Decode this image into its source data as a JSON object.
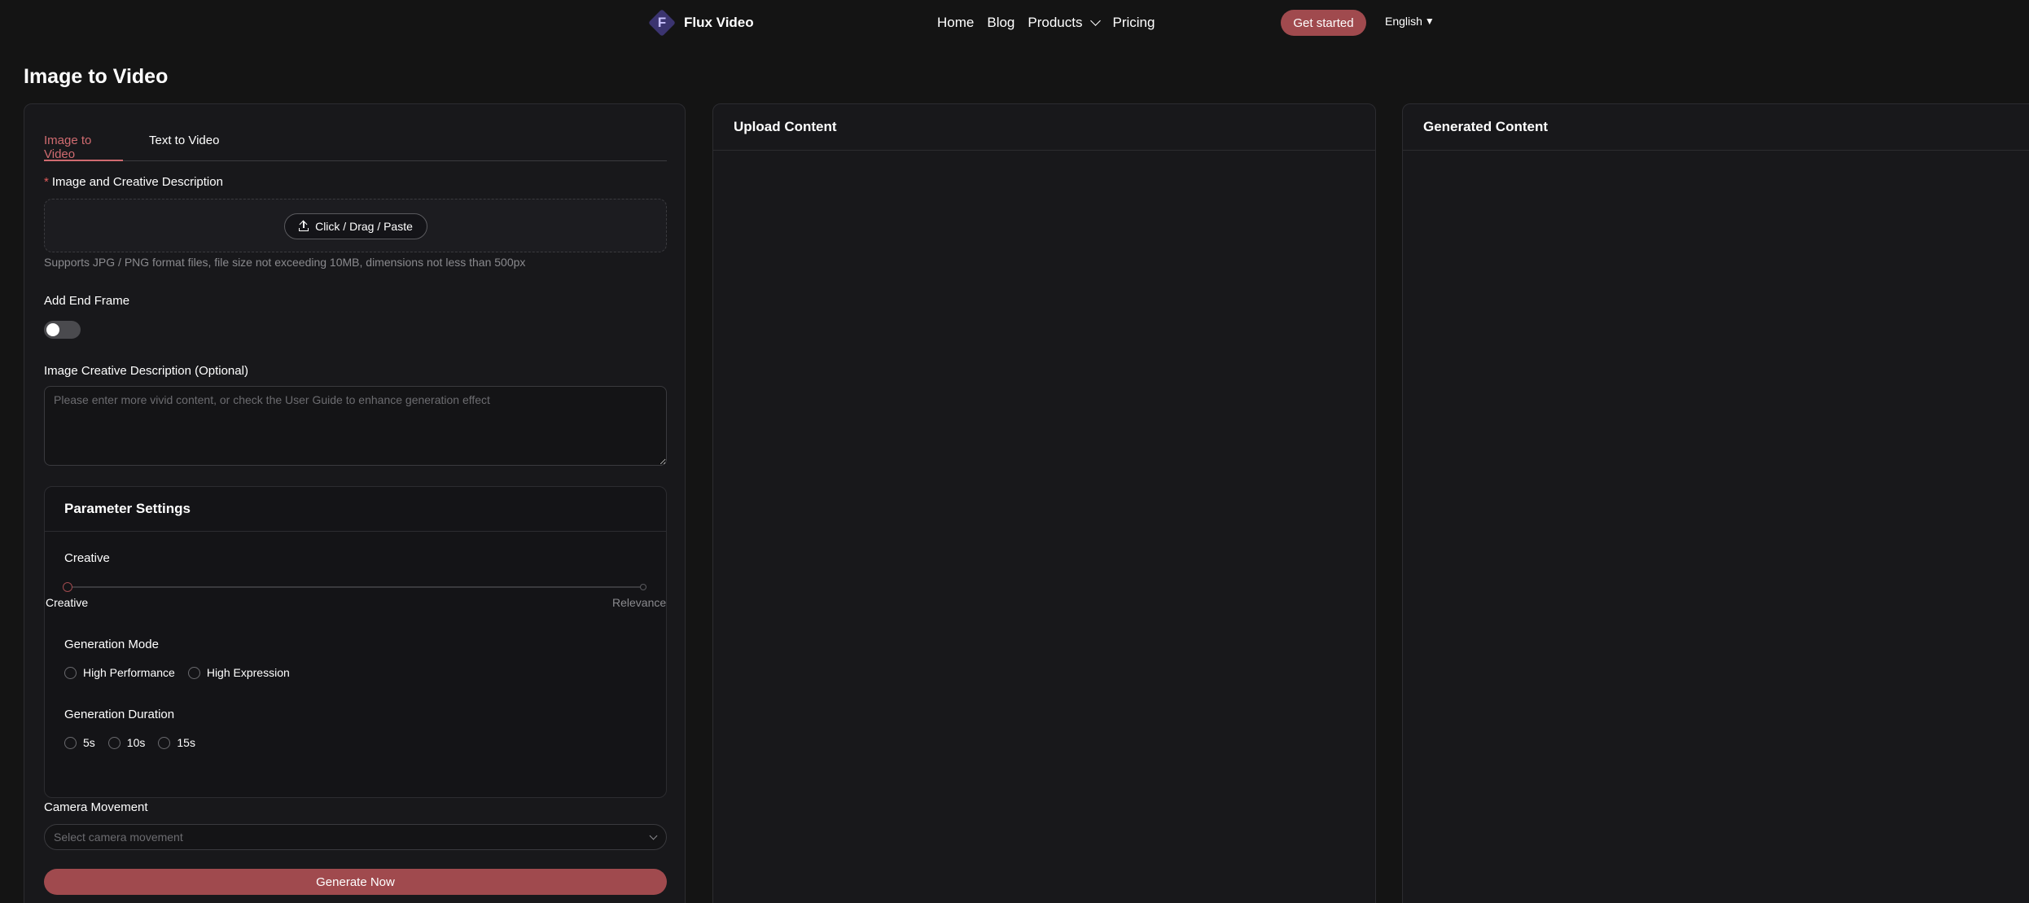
{
  "header": {
    "logo_letter": "F",
    "logo_text": "Flux Video",
    "nav": [
      "Home",
      "Blog",
      "Products",
      "Pricing"
    ],
    "get_started": "Get started",
    "language": "English",
    "language_arrow": "▼"
  },
  "page_title": "Image to Video",
  "left": {
    "tabs": [
      "Image to Video",
      "Text to Video"
    ],
    "active_tab": "Image to Video",
    "image_label": "Image and Creative Description",
    "required_mark": "*",
    "upload_button": "Click / Drag / Paste",
    "upload_hint": "Supports JPG / PNG format files, file size not exceeding 10MB, dimensions not less than 500px",
    "end_frame_label": "Add End Frame",
    "end_frame_enabled": false,
    "description_label": "Image Creative Description (Optional)",
    "description_placeholder": "Please enter more vivid content, or check the User Guide to enhance generation effect",
    "params": {
      "title": "Parameter Settings",
      "creative_label": "Creative",
      "slider_min": "Creative",
      "slider_max": "Relevance",
      "slider_value": 0,
      "mode_label": "Generation Mode",
      "modes": [
        "High Performance",
        "High Expression"
      ],
      "duration_label": "Generation Duration",
      "durations": [
        "5s",
        "10s",
        "15s"
      ]
    },
    "camera_label": "Camera Movement",
    "camera_placeholder": "Select camera movement",
    "generate_button": "Generate Now"
  },
  "upload_panel": {
    "title": "Upload Content"
  },
  "generated_panel": {
    "title": "Generated Content"
  },
  "colors": {
    "accent": "#a04a4e",
    "active_tab": "#d06b70",
    "background": "#141414"
  }
}
